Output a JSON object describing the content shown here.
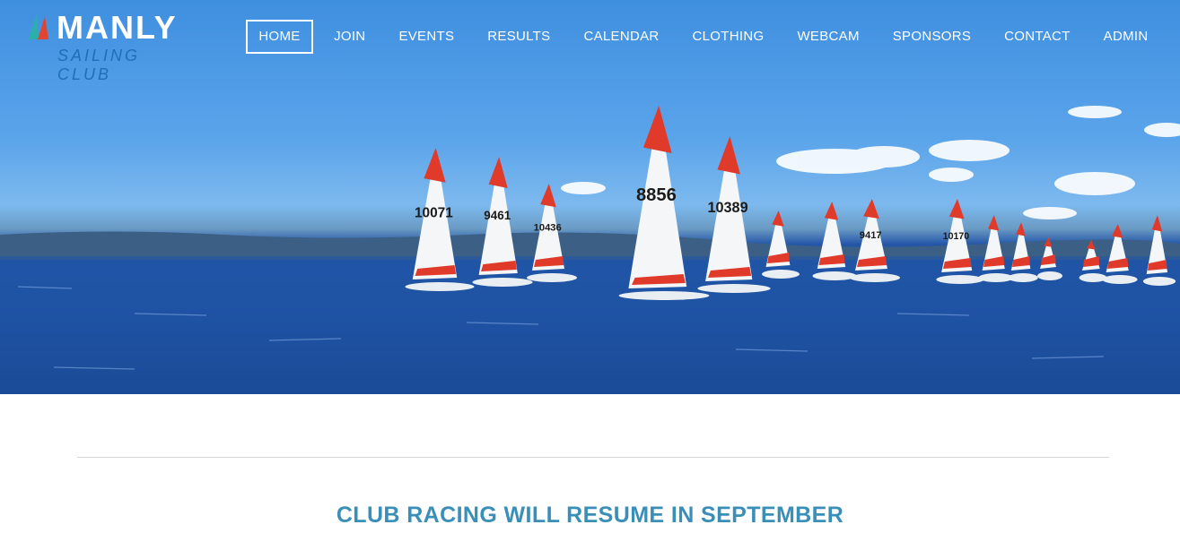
{
  "logo": {
    "title": "MANLY",
    "subtitle": "SAILING CLUB"
  },
  "nav": {
    "items": [
      {
        "label": "HOME",
        "active": true
      },
      {
        "label": "JOIN"
      },
      {
        "label": "EVENTS"
      },
      {
        "label": "RESULTS"
      },
      {
        "label": "CALENDAR"
      },
      {
        "label": "CLOTHING"
      },
      {
        "label": "WEBCAM"
      },
      {
        "label": "SPONSORS"
      },
      {
        "label": "CONTACT"
      },
      {
        "label": "ADMIN"
      }
    ]
  },
  "hero": {
    "sail_numbers": [
      "10071",
      "9461",
      "10436",
      "8856",
      "10389",
      "9417",
      "10170"
    ]
  },
  "main": {
    "headline": "CLUB RACING WILL RESUME IN SEPTEMBER"
  },
  "colors": {
    "accent": "#3a8fb9",
    "logo_sub": "#1d6fb8",
    "sail_red": "#e03a2a"
  }
}
